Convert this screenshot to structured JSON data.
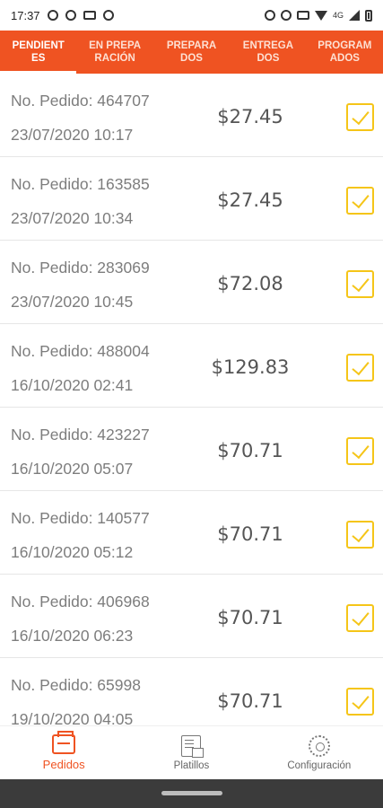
{
  "status_bar": {
    "time": "17:37",
    "left_icons": [
      "at-icon",
      "sync-icon",
      "cast-icon",
      "no-disturb-icon"
    ],
    "right_icons": [
      "alarm-icon",
      "eye-icon",
      "phone-icon",
      "wifi-icon",
      "signal-icon",
      "battery-icon"
    ],
    "network_label": "4G"
  },
  "tabs": [
    {
      "label": "PENDIENT\nES",
      "active": true
    },
    {
      "label": "EN PREPA\nRACIÓN",
      "active": false
    },
    {
      "label": "PREPARA\nDOS",
      "active": false
    },
    {
      "label": "ENTREGA\nDOS",
      "active": false
    },
    {
      "label": "PROGRAM\nADOS",
      "active": false
    }
  ],
  "orders": [
    {
      "id": "No. Pedido: 464707",
      "date": "23/07/2020 10:17",
      "total": "$27.45",
      "checked": true
    },
    {
      "id": "No. Pedido: 163585",
      "date": "23/07/2020 10:34",
      "total": "$27.45",
      "checked": true
    },
    {
      "id": "No. Pedido: 283069",
      "date": "23/07/2020 10:45",
      "total": "$72.08",
      "checked": true
    },
    {
      "id": "No. Pedido: 488004",
      "date": "16/10/2020 02:41",
      "total": "$129.83",
      "checked": true
    },
    {
      "id": "No. Pedido: 423227",
      "date": "16/10/2020 05:07",
      "total": "$70.71",
      "checked": true
    },
    {
      "id": "No. Pedido: 140577",
      "date": "16/10/2020 05:12",
      "total": "$70.71",
      "checked": true
    },
    {
      "id": "No. Pedido: 406968",
      "date": "16/10/2020 06:23",
      "total": "$70.71",
      "checked": true
    },
    {
      "id": "No. Pedido: 65998",
      "date": "19/10/2020 04:05",
      "total": "$70.71",
      "checked": true
    }
  ],
  "bottom_nav": [
    {
      "label": "Pedidos",
      "icon": "orders-icon",
      "active": true
    },
    {
      "label": "Platillos",
      "icon": "dishes-icon",
      "active": false
    },
    {
      "label": "Configuración",
      "icon": "settings-gear-icon",
      "active": false
    }
  ],
  "colors": {
    "accent": "#ef5322",
    "checkbox": "#f5c518",
    "text_muted": "#7d7d7d"
  }
}
